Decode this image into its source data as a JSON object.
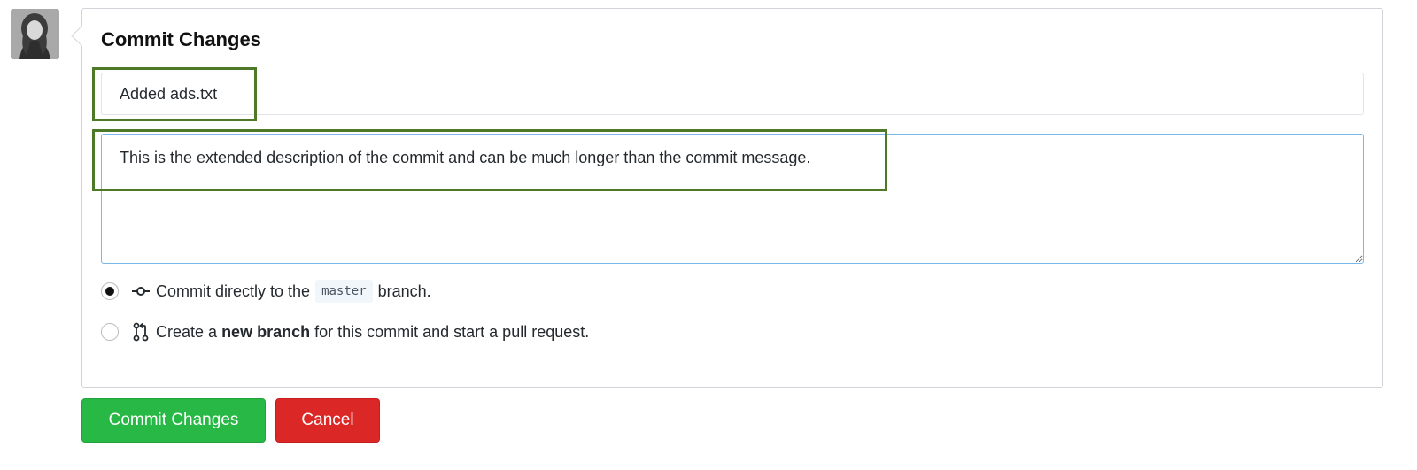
{
  "avatar": {
    "icon": "user-avatar-photo"
  },
  "panel": {
    "title": "Commit Changes"
  },
  "commit_form": {
    "summary_value": "Added ads.txt",
    "description_value": "This is the extended description of the commit and can be much longer than the commit message."
  },
  "options": {
    "direct": {
      "checked": true,
      "icon": "git-commit-icon",
      "text_before": "Commit directly to the",
      "branch_name": "master",
      "text_after": "branch."
    },
    "new_branch": {
      "checked": false,
      "icon": "git-pull-request-icon",
      "text_before": "Create a",
      "text_bold": "new branch",
      "text_after": "for this commit and start a pull request."
    }
  },
  "buttons": {
    "commit_label": "Commit Changes",
    "cancel_label": "Cancel"
  },
  "colors": {
    "commit_button": "#28b845",
    "cancel_button": "#dc2727",
    "highlight_border": "#4e7a27",
    "focus_border": "#79b8e8"
  }
}
